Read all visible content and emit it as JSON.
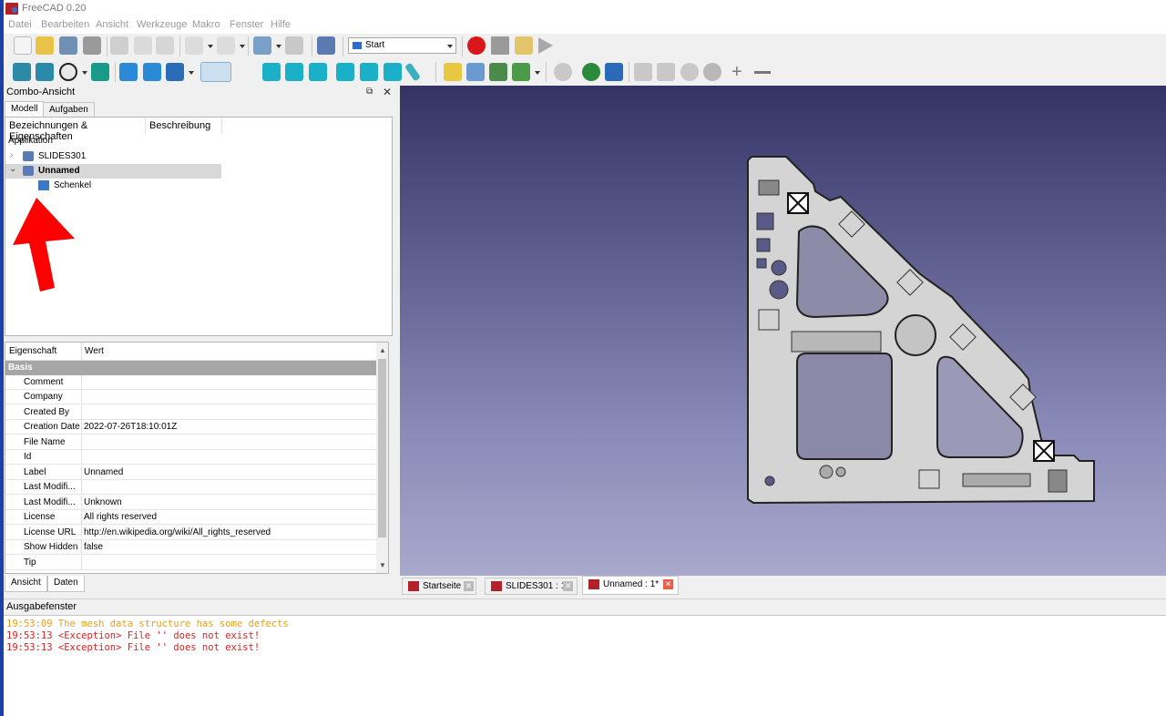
{
  "app": {
    "title": "FreeCAD 0.20"
  },
  "menu": [
    "Datei",
    "Bearbeiten",
    "Ansicht",
    "Werkzeuge",
    "Makro",
    "Fenster",
    "Hilfe"
  ],
  "workbench": {
    "selected": "Start"
  },
  "combo": {
    "title": "Combo-Ansicht",
    "tabs": [
      "Modell",
      "Aufgaben"
    ],
    "tree_headers": [
      "Bezeichnungen & Eigenschaften",
      "Beschreibung"
    ],
    "tree_root": "Applikation",
    "tree_items": [
      {
        "label": "SLIDES301",
        "expanded": false,
        "bold": false
      },
      {
        "label": "Unnamed",
        "expanded": true,
        "bold": true
      },
      {
        "label": "Schenkel",
        "child": true
      }
    ]
  },
  "props": {
    "headers": [
      "Eigenschaft",
      "Wert"
    ],
    "group": "Basis",
    "rows": [
      {
        "key": "Comment",
        "value": ""
      },
      {
        "key": "Company",
        "value": ""
      },
      {
        "key": "Created By",
        "value": ""
      },
      {
        "key": "Creation Date",
        "value": "2022-07-26T18:10:01Z"
      },
      {
        "key": "File Name",
        "value": ""
      },
      {
        "key": "Id",
        "value": ""
      },
      {
        "key": "Label",
        "value": "Unnamed"
      },
      {
        "key": "Last Modifi...",
        "value": ""
      },
      {
        "key": "Last Modifi...",
        "value": "Unknown"
      },
      {
        "key": "License",
        "value": "All rights reserved"
      },
      {
        "key": "License URL",
        "value": "http://en.wikipedia.org/wiki/All_rights_reserved"
      },
      {
        "key": "Show Hidden",
        "value": "false"
      },
      {
        "key": "Tip",
        "value": ""
      }
    ],
    "bottom_tabs": [
      "Ansicht",
      "Daten"
    ]
  },
  "doc_tabs": [
    {
      "label": "Startseite"
    },
    {
      "label": "SLIDES301 : 1"
    },
    {
      "label": "Unnamed : 1*",
      "active": true
    }
  ],
  "output": {
    "title": "Ausgabefenster",
    "lines": [
      {
        "text": "19:53:09  The mesh data structure has some defects",
        "color": "#e8a020"
      },
      {
        "text": "19:53:13  <Exception> File '' does not exist!",
        "color": "#e02020"
      },
      {
        "text": "19:53:13  <Exception> File '' does not exist!",
        "color": "#e02020"
      }
    ]
  },
  "colors": {
    "viewport_top": "#333366",
    "viewport_bottom": "#a8a8cc",
    "annotation_arrow": "#ff0000"
  }
}
